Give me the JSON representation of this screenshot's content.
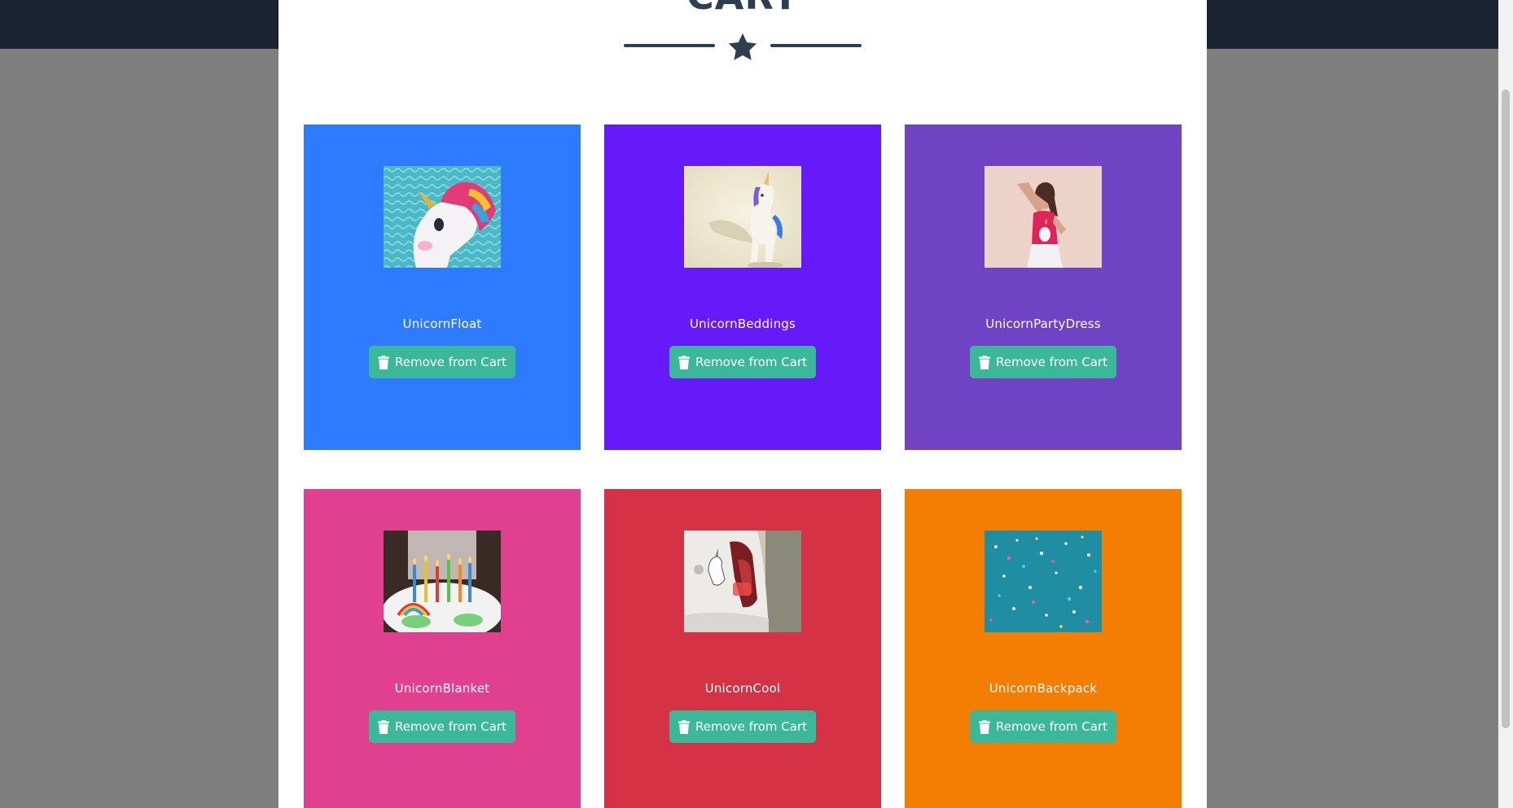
{
  "page": {
    "title": "CART"
  },
  "cart": {
    "items": [
      {
        "name": "UnicornFloat",
        "button": "Remove from Cart",
        "bg": "#2f7bff",
        "image": "unicorn-float-photo"
      },
      {
        "name": "UnicornBeddings",
        "button": "Remove from Cart",
        "bg": "#6619f9",
        "image": "unicorn-figurine-photo"
      },
      {
        "name": "UnicornPartyDress",
        "button": "Remove from Cart",
        "bg": "#7043c5",
        "image": "girl-unicorn-shirt-photo"
      },
      {
        "name": "UnicornBlanket",
        "button": "Remove from Cart",
        "bg": "#e0408f",
        "image": "birthday-cake-photo"
      },
      {
        "name": "UnicornCool",
        "button": "Remove from Cart",
        "bg": "#d53345",
        "image": "car-unicorn-sticker-photo"
      },
      {
        "name": "UnicornBackpack",
        "button": "Remove from Cart",
        "bg": "#f47d04",
        "image": "confetti-photo"
      }
    ]
  },
  "colors": {
    "topbar": "#1a2332",
    "title": "#2c3e50",
    "button": "#3bb89a",
    "overlay": "#7f7f7f"
  },
  "icons": {
    "divider": "star-icon",
    "button": "trash-icon"
  }
}
